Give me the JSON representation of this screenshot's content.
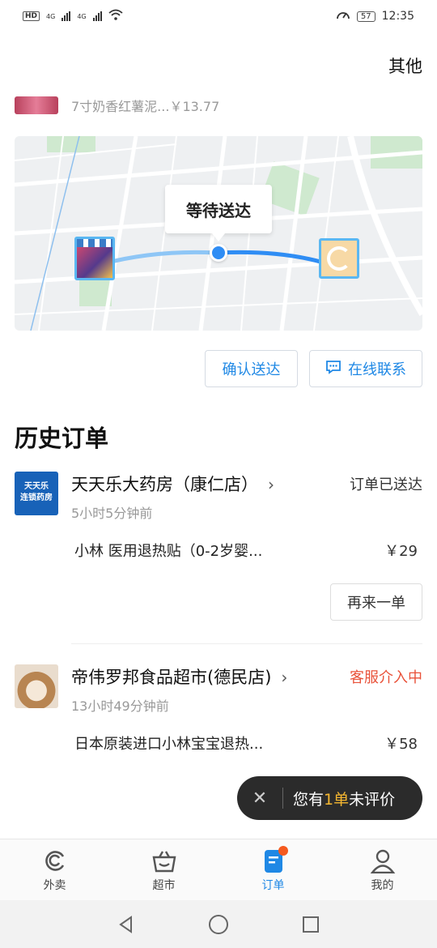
{
  "status_bar": {
    "hd": "HD",
    "net1": "4G",
    "net2": "4G",
    "battery": "57",
    "time": "12:35"
  },
  "header": {
    "other_label": "其他"
  },
  "current_order": {
    "item_text": "7寸奶香红薯泥...￥13.77",
    "map_status": "等待送达",
    "confirm_label": "确认送达",
    "chat_label": "在线联系"
  },
  "history": {
    "title": "历史订单",
    "orders": [
      {
        "logo_text_1": "天天乐",
        "logo_text_2": "连锁药房",
        "shop": "天天乐大药房（康仁店）",
        "status": "订单已送达",
        "time": "5小时5分钟前",
        "goods": "小林  医用退热贴（0-2岁婴...",
        "price": "￥29",
        "action": "再来一单"
      },
      {
        "shop": "帝伟罗邦食品超市(德民店)",
        "status": "客服介入中",
        "time": "13小时49分钟前",
        "goods": "日本原装进口小林宝宝退热...",
        "price": "￥58"
      }
    ]
  },
  "toast": {
    "prefix": "您有",
    "highlight": "1单",
    "suffix": "未评价"
  },
  "tabs": [
    {
      "label": "外卖",
      "icon": "eleme-icon"
    },
    {
      "label": "超市",
      "icon": "basket-icon"
    },
    {
      "label": "订单",
      "icon": "order-icon"
    },
    {
      "label": "我的",
      "icon": "profile-icon"
    }
  ],
  "colors": {
    "accent": "#1f88e5",
    "warn": "#e9533b",
    "toast_highlight": "#f5b731"
  }
}
